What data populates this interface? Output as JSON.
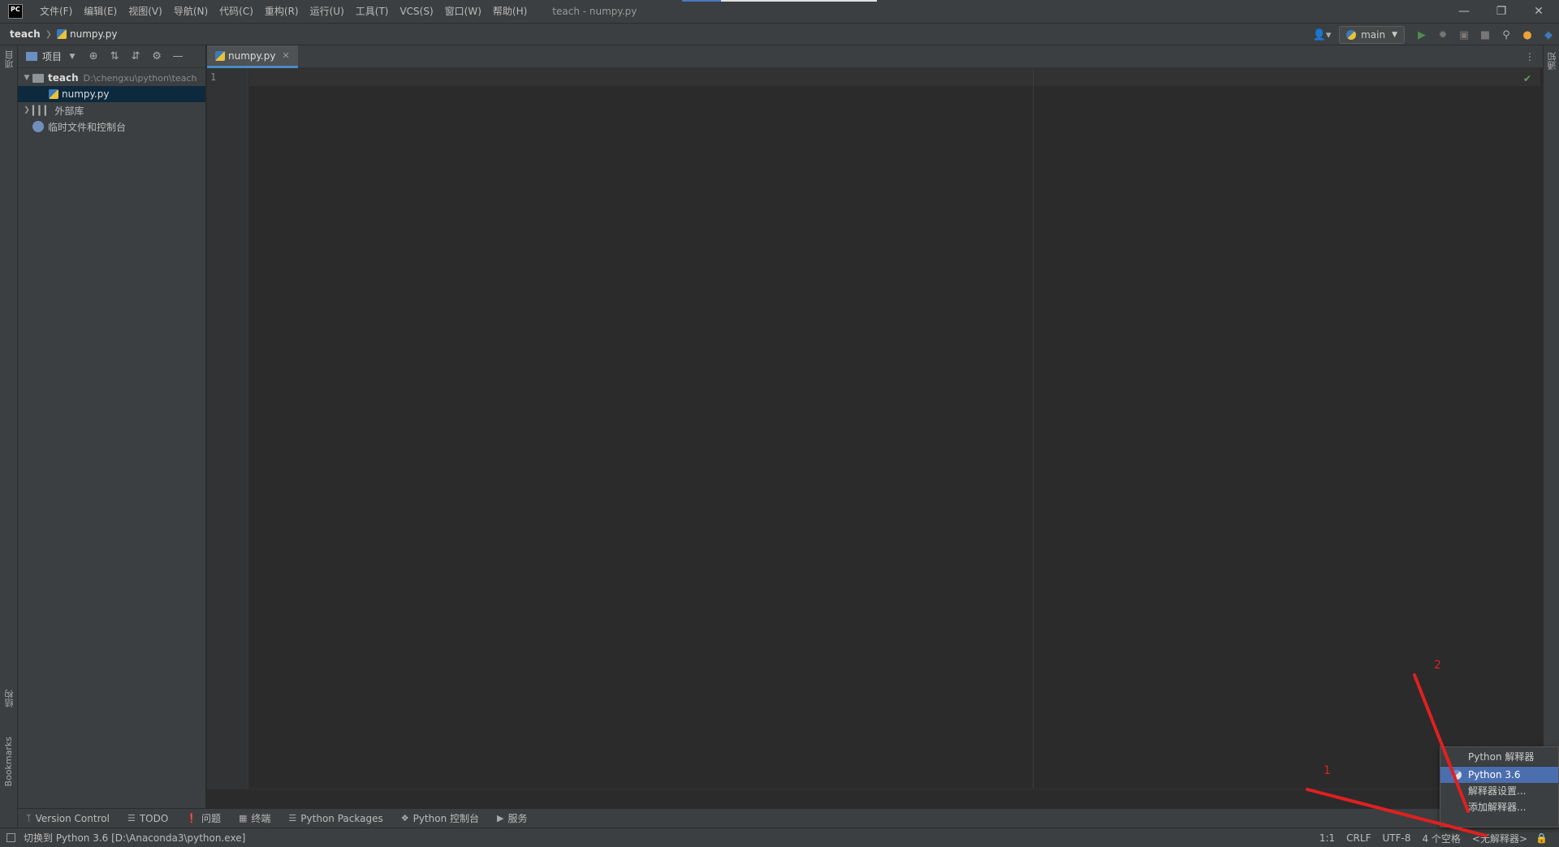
{
  "app": {
    "logo_text": "PC",
    "window_title": "teach - numpy.py"
  },
  "menu": [
    "文件(F)",
    "编辑(E)",
    "视图(V)",
    "导航(N)",
    "代码(C)",
    "重构(R)",
    "运行(U)",
    "工具(T)",
    "VCS(S)",
    "窗口(W)",
    "帮助(H)"
  ],
  "breadcrumb": {
    "root": "teach",
    "file": "numpy.py"
  },
  "toolbar": {
    "run_config": "main"
  },
  "left_stripe": {
    "project_label": "项目",
    "structure_label": "结构",
    "bookmarks_label": "Bookmarks"
  },
  "right_stripe": {
    "notifications_label": "通知"
  },
  "project_panel": {
    "title": "项目",
    "tree": {
      "root_name": "teach",
      "root_path": "D:\\chengxu\\python\\teach",
      "file_name": "numpy.py",
      "external_libs": "外部库",
      "scratches": "临时文件和控制台"
    }
  },
  "editor": {
    "tab_label": "numpy.py",
    "line_number": "1"
  },
  "tool_tabs": [
    "Version Control",
    "TODO",
    "问题",
    "终端",
    "Python Packages",
    "Python 控制台",
    "服务"
  ],
  "status": {
    "message": "切换到 Python 3.6 [D:\\Anaconda3\\python.exe]",
    "position": "1:1",
    "line_sep": "CRLF",
    "encoding": "UTF-8",
    "indent": "4 个空格",
    "interpreter": "<无解释器>"
  },
  "popup": {
    "title": "Python 解释器",
    "items": [
      "Python 3.6",
      "解释器设置...",
      "添加解释器..."
    ]
  },
  "annotations": {
    "label_1": "1",
    "label_2": "2",
    "color": "#e02020"
  },
  "colors": {
    "accent": "#4a88c7",
    "selection": "#4b6eaf",
    "background": "#2b2b2b",
    "panel": "#3c3f41"
  }
}
